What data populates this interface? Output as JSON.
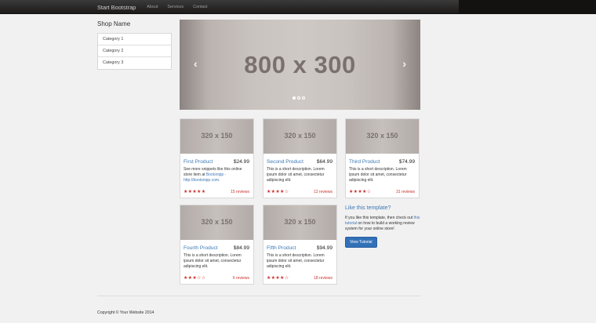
{
  "navbar": {
    "brand": "Start Bootstrap",
    "links": [
      "About",
      "Services",
      "Contact"
    ]
  },
  "sidebar": {
    "shop_name": "Shop Name",
    "categories": [
      "Category 1",
      "Category 2",
      "Category 3"
    ]
  },
  "carousel": {
    "placeholder": "800 x 300",
    "prev": "‹",
    "next": "›",
    "slide_count": 3,
    "active_slide": 1
  },
  "products": [
    {
      "image_placeholder": "320 x 150",
      "name": "First Product",
      "price": "$24.99",
      "desc_prefix": "See more snippets like this online store item at ",
      "desc_link": "Bootsnipp - http://bootsnipp.com",
      "desc_suffix": ".",
      "stars": "★★★★★",
      "rating": 5,
      "reviews": "15 reviews"
    },
    {
      "image_placeholder": "320 x 150",
      "name": "Second Product",
      "price": "$64.99",
      "desc": "This is a short description. Lorem ipsum dolor sit amet, consectetur adipiscing elit.",
      "stars": "★★★★☆",
      "rating": 4,
      "reviews": "12 reviews"
    },
    {
      "image_placeholder": "320 x 150",
      "name": "Third Product",
      "price": "$74.99",
      "desc": "This is a short description. Lorem ipsum dolor sit amet, consectetur adipiscing elit.",
      "stars": "★★★★☆",
      "rating": 4,
      "reviews": "31 reviews"
    },
    {
      "image_placeholder": "320 x 150",
      "name": "Fourth Product",
      "price": "$84.99",
      "desc": "This is a short description. Lorem ipsum dolor sit amet, consectetur adipiscing elit.",
      "stars": "★★★☆☆",
      "rating": 3,
      "reviews": "6 reviews"
    },
    {
      "image_placeholder": "320 x 150",
      "name": "Fifth Product",
      "price": "$94.99",
      "desc": "This is a short description. Lorem ipsum dolor sit amet, consectetur adipiscing elit.",
      "stars": "★★★★☆",
      "rating": 4,
      "reviews": "18 reviews"
    }
  ],
  "promo": {
    "title": "Like this template?",
    "text_prefix": "If you like this template, then check out ",
    "link": "this tutorial",
    "text_suffix": " on how to build a working review system for your online store!",
    "button": "View Tutorial"
  },
  "footer": {
    "copyright": "Copyright © Your Website 2014"
  },
  "colors": {
    "accent": "#3c78b5",
    "navbar": "#1e1b1a",
    "rating": "#c9302c",
    "button": "#3171b8"
  }
}
